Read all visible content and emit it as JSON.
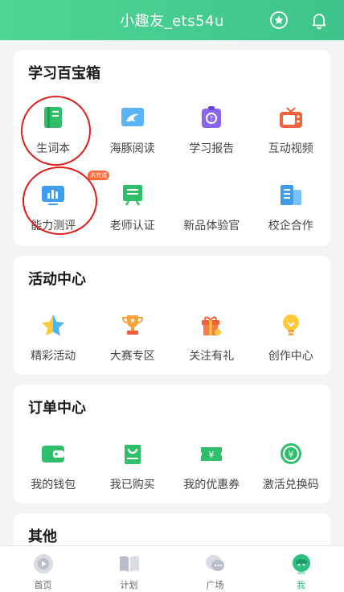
{
  "header": {
    "title": "小趣友_ets54u"
  },
  "toolbox": {
    "title": "学习百宝箱",
    "row1": [
      {
        "label": "生词本",
        "icon": "vocab-book-icon"
      },
      {
        "label": "海豚阅读",
        "icon": "dolphin-reading-icon"
      },
      {
        "label": "学习报告",
        "icon": "study-report-icon"
      },
      {
        "label": "互动视频",
        "icon": "interactive-video-icon"
      }
    ],
    "row2": [
      {
        "label": "能力测评",
        "icon": "ability-test-icon",
        "badge": "未完成"
      },
      {
        "label": "老师认证",
        "icon": "teacher-cert-icon"
      },
      {
        "label": "新品体验官",
        "icon": ""
      },
      {
        "label": "校企合作",
        "icon": "school-cooperation-icon"
      }
    ]
  },
  "activity": {
    "title": "活动中心",
    "items": [
      {
        "label": "精彩活动",
        "icon": "star-icon"
      },
      {
        "label": "大赛专区",
        "icon": "trophy-icon"
      },
      {
        "label": "关注有礼",
        "icon": "gift-icon"
      },
      {
        "label": "创作中心",
        "icon": "lightbulb-icon"
      }
    ]
  },
  "orders": {
    "title": "订单中心",
    "items": [
      {
        "label": "我的钱包",
        "icon": "wallet-icon"
      },
      {
        "label": "我已购买",
        "icon": "purchased-bag-icon"
      },
      {
        "label": "我的优惠券",
        "icon": "coupon-icon"
      },
      {
        "label": "激活兑换码",
        "icon": "redeem-code-icon"
      }
    ]
  },
  "other": {
    "title": "其他"
  },
  "tabbar": [
    {
      "label": "首页",
      "icon": "home-play-icon"
    },
    {
      "label": "计划",
      "icon": "plan-book-icon"
    },
    {
      "label": "广场",
      "icon": "square-chat-icon"
    },
    {
      "label": "我",
      "icon": "me-avatar-icon",
      "active": true
    }
  ],
  "colors": {
    "brand": "#3dc48a",
    "accent": "#2fbf80",
    "badge": "#ff6a3d",
    "annotation": "#e21b1b"
  }
}
